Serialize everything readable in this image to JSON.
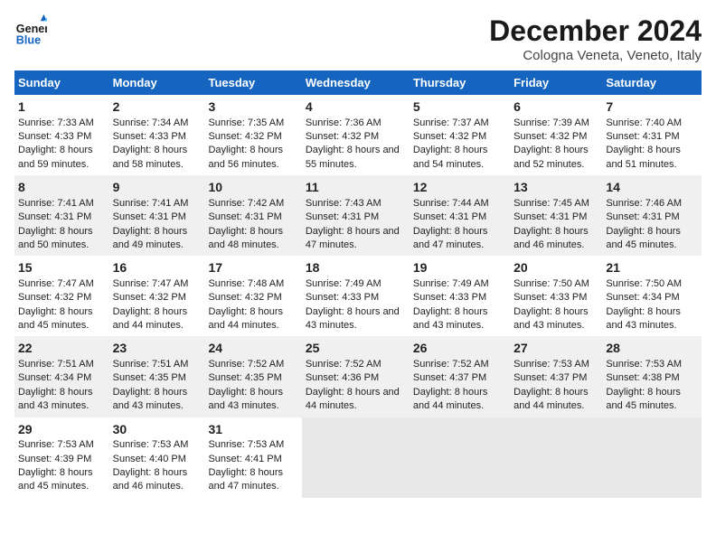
{
  "logo": {
    "line1": "General",
    "line2": "Blue"
  },
  "title": "December 2024",
  "subtitle": "Cologna Veneta, Veneto, Italy",
  "days_header": [
    "Sunday",
    "Monday",
    "Tuesday",
    "Wednesday",
    "Thursday",
    "Friday",
    "Saturday"
  ],
  "weeks": [
    [
      {
        "day": "1",
        "sunrise": "Sunrise: 7:33 AM",
        "sunset": "Sunset: 4:33 PM",
        "daylight": "Daylight: 8 hours and 59 minutes."
      },
      {
        "day": "2",
        "sunrise": "Sunrise: 7:34 AM",
        "sunset": "Sunset: 4:33 PM",
        "daylight": "Daylight: 8 hours and 58 minutes."
      },
      {
        "day": "3",
        "sunrise": "Sunrise: 7:35 AM",
        "sunset": "Sunset: 4:32 PM",
        "daylight": "Daylight: 8 hours and 56 minutes."
      },
      {
        "day": "4",
        "sunrise": "Sunrise: 7:36 AM",
        "sunset": "Sunset: 4:32 PM",
        "daylight": "Daylight: 8 hours and 55 minutes."
      },
      {
        "day": "5",
        "sunrise": "Sunrise: 7:37 AM",
        "sunset": "Sunset: 4:32 PM",
        "daylight": "Daylight: 8 hours and 54 minutes."
      },
      {
        "day": "6",
        "sunrise": "Sunrise: 7:39 AM",
        "sunset": "Sunset: 4:32 PM",
        "daylight": "Daylight: 8 hours and 52 minutes."
      },
      {
        "day": "7",
        "sunrise": "Sunrise: 7:40 AM",
        "sunset": "Sunset: 4:31 PM",
        "daylight": "Daylight: 8 hours and 51 minutes."
      }
    ],
    [
      {
        "day": "8",
        "sunrise": "Sunrise: 7:41 AM",
        "sunset": "Sunset: 4:31 PM",
        "daylight": "Daylight: 8 hours and 50 minutes."
      },
      {
        "day": "9",
        "sunrise": "Sunrise: 7:41 AM",
        "sunset": "Sunset: 4:31 PM",
        "daylight": "Daylight: 8 hours and 49 minutes."
      },
      {
        "day": "10",
        "sunrise": "Sunrise: 7:42 AM",
        "sunset": "Sunset: 4:31 PM",
        "daylight": "Daylight: 8 hours and 48 minutes."
      },
      {
        "day": "11",
        "sunrise": "Sunrise: 7:43 AM",
        "sunset": "Sunset: 4:31 PM",
        "daylight": "Daylight: 8 hours and 47 minutes."
      },
      {
        "day": "12",
        "sunrise": "Sunrise: 7:44 AM",
        "sunset": "Sunset: 4:31 PM",
        "daylight": "Daylight: 8 hours and 47 minutes."
      },
      {
        "day": "13",
        "sunrise": "Sunrise: 7:45 AM",
        "sunset": "Sunset: 4:31 PM",
        "daylight": "Daylight: 8 hours and 46 minutes."
      },
      {
        "day": "14",
        "sunrise": "Sunrise: 7:46 AM",
        "sunset": "Sunset: 4:31 PM",
        "daylight": "Daylight: 8 hours and 45 minutes."
      }
    ],
    [
      {
        "day": "15",
        "sunrise": "Sunrise: 7:47 AM",
        "sunset": "Sunset: 4:32 PM",
        "daylight": "Daylight: 8 hours and 45 minutes."
      },
      {
        "day": "16",
        "sunrise": "Sunrise: 7:47 AM",
        "sunset": "Sunset: 4:32 PM",
        "daylight": "Daylight: 8 hours and 44 minutes."
      },
      {
        "day": "17",
        "sunrise": "Sunrise: 7:48 AM",
        "sunset": "Sunset: 4:32 PM",
        "daylight": "Daylight: 8 hours and 44 minutes."
      },
      {
        "day": "18",
        "sunrise": "Sunrise: 7:49 AM",
        "sunset": "Sunset: 4:33 PM",
        "daylight": "Daylight: 8 hours and 43 minutes."
      },
      {
        "day": "19",
        "sunrise": "Sunrise: 7:49 AM",
        "sunset": "Sunset: 4:33 PM",
        "daylight": "Daylight: 8 hours and 43 minutes."
      },
      {
        "day": "20",
        "sunrise": "Sunrise: 7:50 AM",
        "sunset": "Sunset: 4:33 PM",
        "daylight": "Daylight: 8 hours and 43 minutes."
      },
      {
        "day": "21",
        "sunrise": "Sunrise: 7:50 AM",
        "sunset": "Sunset: 4:34 PM",
        "daylight": "Daylight: 8 hours and 43 minutes."
      }
    ],
    [
      {
        "day": "22",
        "sunrise": "Sunrise: 7:51 AM",
        "sunset": "Sunset: 4:34 PM",
        "daylight": "Daylight: 8 hours and 43 minutes."
      },
      {
        "day": "23",
        "sunrise": "Sunrise: 7:51 AM",
        "sunset": "Sunset: 4:35 PM",
        "daylight": "Daylight: 8 hours and 43 minutes."
      },
      {
        "day": "24",
        "sunrise": "Sunrise: 7:52 AM",
        "sunset": "Sunset: 4:35 PM",
        "daylight": "Daylight: 8 hours and 43 minutes."
      },
      {
        "day": "25",
        "sunrise": "Sunrise: 7:52 AM",
        "sunset": "Sunset: 4:36 PM",
        "daylight": "Daylight: 8 hours and 44 minutes."
      },
      {
        "day": "26",
        "sunrise": "Sunrise: 7:52 AM",
        "sunset": "Sunset: 4:37 PM",
        "daylight": "Daylight: 8 hours and 44 minutes."
      },
      {
        "day": "27",
        "sunrise": "Sunrise: 7:53 AM",
        "sunset": "Sunset: 4:37 PM",
        "daylight": "Daylight: 8 hours and 44 minutes."
      },
      {
        "day": "28",
        "sunrise": "Sunrise: 7:53 AM",
        "sunset": "Sunset: 4:38 PM",
        "daylight": "Daylight: 8 hours and 45 minutes."
      }
    ],
    [
      {
        "day": "29",
        "sunrise": "Sunrise: 7:53 AM",
        "sunset": "Sunset: 4:39 PM",
        "daylight": "Daylight: 8 hours and 45 minutes."
      },
      {
        "day": "30",
        "sunrise": "Sunrise: 7:53 AM",
        "sunset": "Sunset: 4:40 PM",
        "daylight": "Daylight: 8 hours and 46 minutes."
      },
      {
        "day": "31",
        "sunrise": "Sunrise: 7:53 AM",
        "sunset": "Sunset: 4:41 PM",
        "daylight": "Daylight: 8 hours and 47 minutes."
      },
      null,
      null,
      null,
      null
    ]
  ]
}
